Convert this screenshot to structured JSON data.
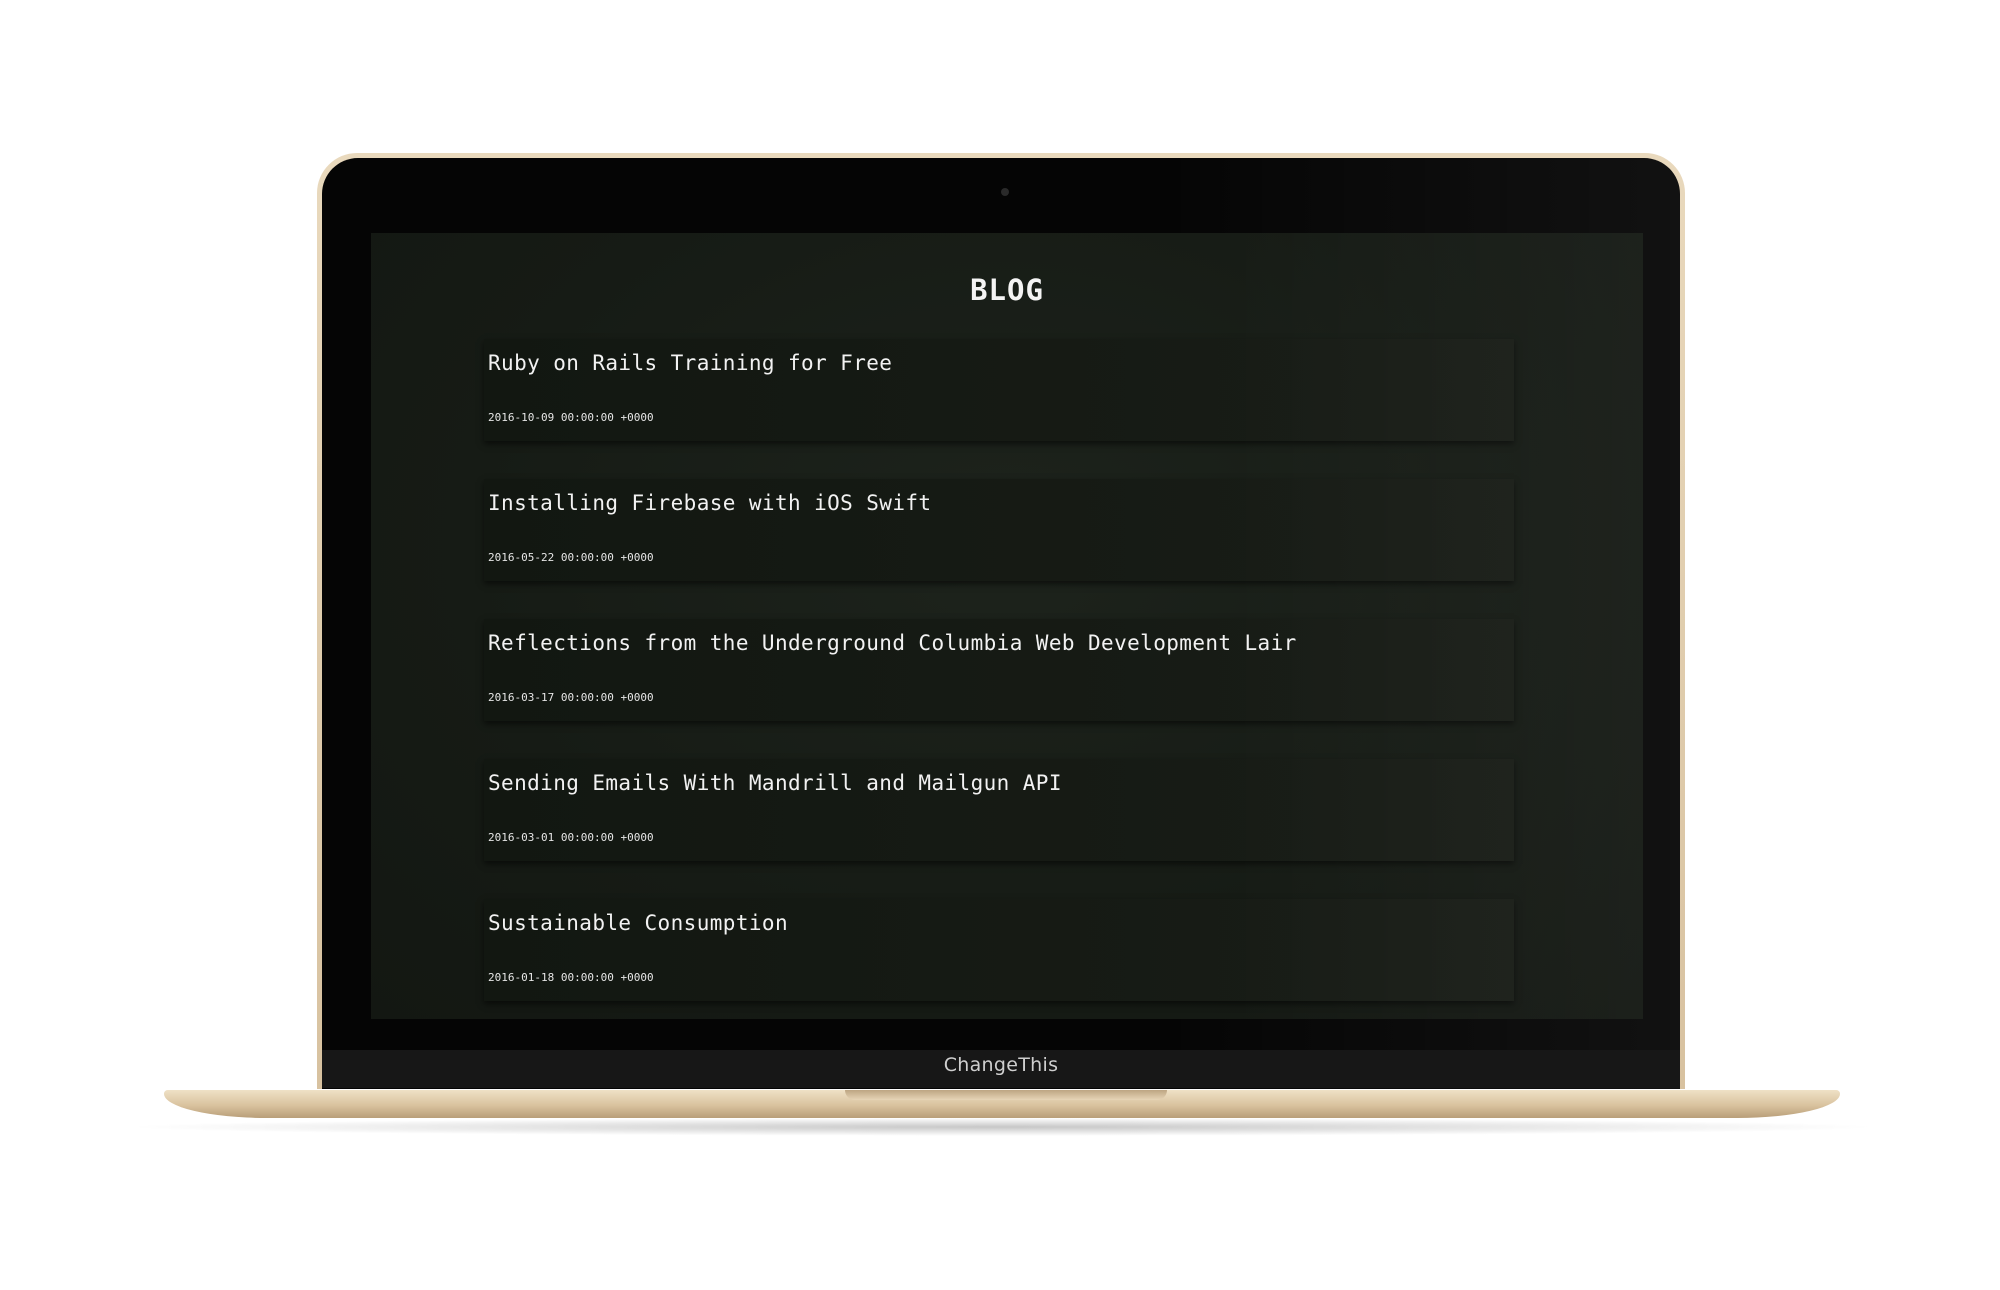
{
  "laptop": {
    "brand_label": "ChangeThis"
  },
  "page": {
    "title": "BLOG"
  },
  "posts": [
    {
      "title": "Ruby on Rails Training for Free",
      "date": "2016-10-09 00:00:00 +0000"
    },
    {
      "title": "Installing Firebase with iOS Swift",
      "date": "2016-05-22 00:00:00 +0000"
    },
    {
      "title": "Reflections from the Underground Columbia Web Development Lair",
      "date": "2016-03-17 00:00:00 +0000"
    },
    {
      "title": "Sending Emails With Mandrill and Mailgun API",
      "date": "2016-03-01 00:00:00 +0000"
    },
    {
      "title": "Sustainable Consumption",
      "date": "2016-01-18 00:00:00 +0000"
    }
  ],
  "colors": {
    "screen_background": "#161b15",
    "card_background": "#151a14",
    "text": "#f2f2f2",
    "laptop_gold": "#d8c2a0"
  }
}
